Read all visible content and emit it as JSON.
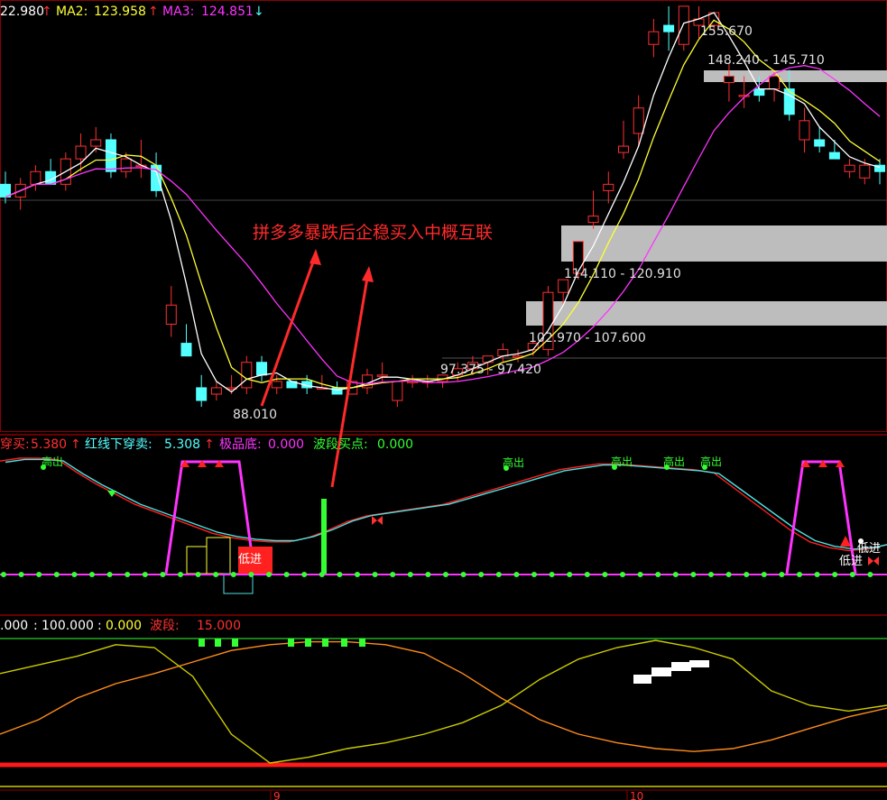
{
  "price_panel": {
    "ma1_value": "22.980",
    "ma1_arrow": "↑",
    "ma2_label": "MA2:",
    "ma2_value": "123.958",
    "ma2_arrow": "↑",
    "ma3_label": "MA3:",
    "ma3_value": "124.851",
    "ma3_arrow": "↓",
    "annotation": "拼多多暴跌后企稳买入中概互联",
    "high_label": "155.670",
    "low_label": "88.010",
    "zones": [
      {
        "label": "148.240 - 145.710"
      },
      {
        "label": "114.110 - 120.910"
      },
      {
        "label": "102.970 - 107.600"
      },
      {
        "label": "97.375 - 97.420"
      }
    ]
  },
  "indicator_panel": {
    "item1_label": "穿买:",
    "item1_value": "5.380",
    "item1_arrow": "↑",
    "item2_label": "红线下穿卖:",
    "item2_value": "5.308",
    "item2_arrow": "↑",
    "item3_label": "极品底:",
    "item3_value": "0.000",
    "item4_label": "波段买点:",
    "item4_value": "0.000",
    "sell_marks": [
      "高出",
      "高出",
      "高出",
      "高出",
      "高出"
    ],
    "buy_marks": [
      "低进",
      "低进",
      "低进"
    ]
  },
  "osc_panel": {
    "v1": ".000",
    "sep1": ":",
    "v2": "100.000",
    "sep2": ":",
    "v3": "0.000",
    "item_label": "波段:",
    "item_value": "15.000"
  },
  "axis": {
    "ticks": [
      "9",
      "10"
    ]
  },
  "colors": {
    "up": "#ff3030",
    "down": "#54ffff",
    "ma1": "#ffffff",
    "ma2": "#ffff33",
    "ma3": "#ff33ff",
    "panel_border": "#8b0000",
    "zone": "#bdbdbd",
    "green": "#33ff33"
  },
  "chart_data": [
    {
      "type": "candlestick",
      "title": "",
      "series": [
        {
          "name": "MA2",
          "type": "line"
        },
        {
          "name": "MA3",
          "type": "line"
        }
      ],
      "ohlc_approx": [
        [
          128,
          130,
          125,
          126
        ],
        [
          126,
          129,
          124,
          128
        ],
        [
          128,
          131,
          127,
          130
        ],
        [
          130,
          132,
          128,
          128
        ],
        [
          128,
          133,
          127,
          132
        ],
        [
          132,
          136,
          130,
          134
        ],
        [
          134,
          137,
          133,
          135
        ],
        [
          135,
          136,
          129,
          130
        ],
        [
          130,
          133,
          129,
          132
        ],
        [
          131,
          135,
          129,
          131
        ],
        [
          131,
          133,
          126,
          127
        ],
        [
          106,
          112,
          104,
          109
        ],
        [
          103,
          106,
          101,
          101
        ],
        [
          96,
          98,
          93,
          94
        ],
        [
          95,
          97,
          94,
          96
        ],
        [
          96,
          98,
          95,
          96
        ],
        [
          96,
          101,
          95,
          100
        ],
        [
          100,
          101,
          97,
          98
        ],
        [
          96,
          98,
          95,
          97
        ],
        [
          97,
          97,
          96,
          96
        ],
        [
          97,
          98,
          95,
          96
        ],
        [
          96,
          98,
          96,
          96
        ],
        [
          96,
          97,
          95,
          95
        ],
        [
          95,
          97,
          95,
          97
        ],
        [
          96,
          99,
          95,
          98
        ],
        [
          98,
          100,
          97,
          98
        ],
        [
          94,
          97,
          93,
          97
        ],
        [
          97,
          98,
          96,
          97
        ],
        [
          97,
          98,
          96,
          97
        ],
        [
          97,
          98,
          96,
          98
        ],
        [
          98,
          100,
          97,
          99
        ],
        [
          99,
          101,
          98,
          100
        ],
        [
          100,
          101,
          98,
          101
        ],
        [
          101,
          103,
          100,
          102
        ],
        [
          101,
          102,
          100,
          101
        ],
        [
          102,
          104,
          101,
          103
        ],
        [
          102,
          112,
          101,
          111
        ],
        [
          111,
          113,
          109,
          113
        ],
        [
          114,
          119,
          113,
          119
        ],
        [
          122,
          127,
          121,
          123
        ],
        [
          127,
          130,
          125,
          128
        ],
        [
          133,
          138,
          132,
          134
        ],
        [
          136,
          142,
          134,
          140
        ],
        [
          150,
          154,
          148,
          152
        ],
        [
          153,
          156,
          149,
          152
        ],
        [
          150,
          156,
          149,
          156
        ],
        [
          153,
          156,
          151,
          154
        ],
        [
          153,
          155,
          152,
          155
        ],
        [
          144,
          147,
          141,
          145
        ],
        [
          142,
          145,
          140,
          142
        ],
        [
          143,
          145,
          141,
          142
        ],
        [
          143,
          146,
          141,
          145
        ],
        [
          143,
          146,
          138,
          139
        ],
        [
          135,
          140,
          133,
          138
        ],
        [
          135,
          137,
          133,
          134
        ],
        [
          133,
          135,
          132,
          132
        ],
        [
          130,
          132,
          129,
          131
        ],
        [
          129,
          132,
          128,
          131
        ],
        [
          131,
          132,
          128,
          130
        ]
      ],
      "annotations": [
        "155.670",
        "88.010",
        "148.240 - 145.710",
        "114.110 - 120.910",
        "102.970 - 107.600",
        "97.375 - 97.420"
      ]
    },
    {
      "type": "line",
      "series": [
        {
          "name": "红线下穿卖",
          "values": [
            78,
            80,
            80,
            79,
            70,
            62,
            55,
            48,
            43,
            38,
            33,
            28,
            25,
            23,
            22,
            22,
            25,
            30,
            36,
            40,
            42,
            44,
            46,
            48,
            52,
            56,
            60,
            64,
            68,
            72,
            74,
            76,
            76,
            75,
            74,
            73,
            72,
            70,
            60,
            50,
            40,
            30,
            22,
            18,
            16,
            17,
            20
          ]
        }
      ]
    },
    {
      "type": "line",
      "series": [
        {
          "name": "波段",
          "values": [
            20,
            30,
            45,
            55,
            62,
            70,
            78,
            82,
            84,
            84,
            82,
            76,
            62,
            45,
            30,
            20,
            14,
            10,
            8,
            10,
            16,
            24,
            32,
            38
          ]
        }
      ]
    }
  ]
}
